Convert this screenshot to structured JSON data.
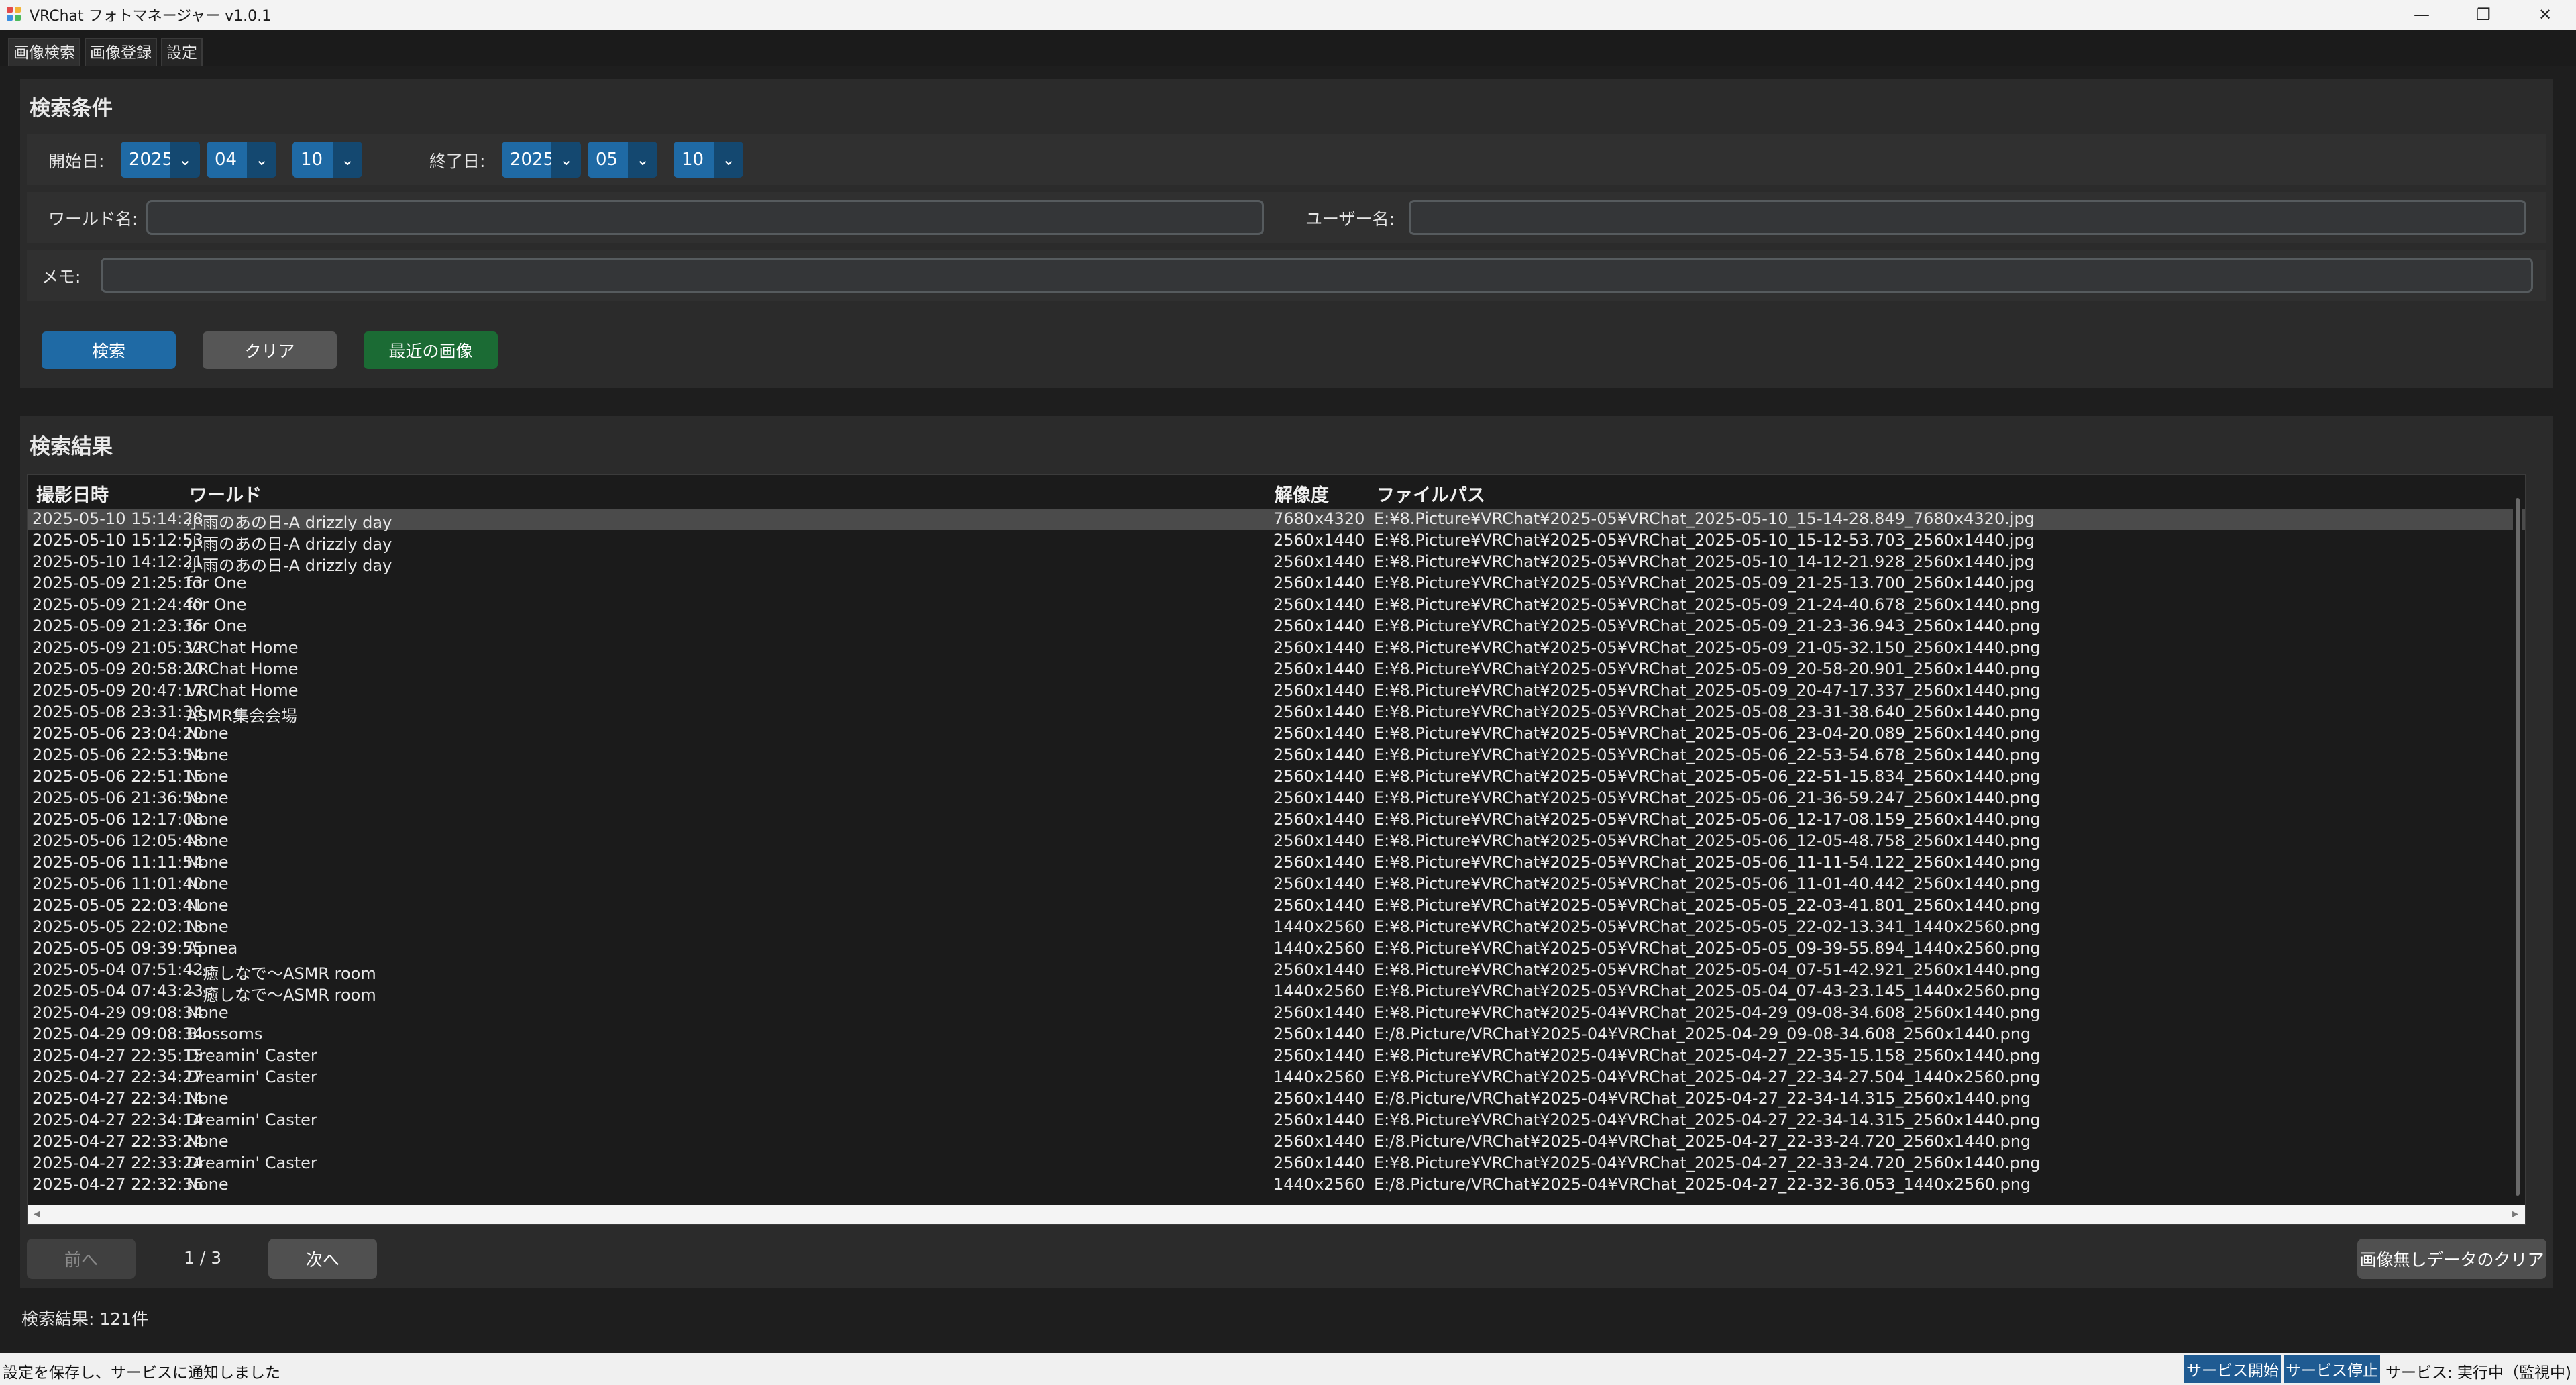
{
  "window": {
    "title": "VRChat フォトマネージャー v1.0.1",
    "controls": [
      "—",
      "❐",
      "✕"
    ]
  },
  "tabs": [
    "画像検索",
    "画像登録",
    "設定"
  ],
  "search": {
    "title": "検索条件",
    "start_label": "開始日:",
    "start": {
      "year": "2025",
      "month": "04",
      "day": "10"
    },
    "end_label": "終了日:",
    "end": {
      "year": "2025",
      "month": "05",
      "day": "10"
    },
    "world_label": "ワールド名:",
    "world_value": "",
    "user_label": "ユーザー名:",
    "user_value": "",
    "memo_label": "メモ:",
    "memo_value": "",
    "search_btn": "検索",
    "clear_btn": "クリア",
    "recent_btn": "最近の画像"
  },
  "results": {
    "title": "検索結果",
    "columns": [
      "撮影日時",
      "ワールド",
      "解像度",
      "ファイルパス"
    ],
    "rows": [
      [
        "2025-05-10 15:14:28",
        "小雨のあの日-A drizzly day",
        "7680x4320",
        "E:¥8.Picture¥VRChat¥2025-05¥VRChat_2025-05-10_15-14-28.849_7680x4320.jpg"
      ],
      [
        "2025-05-10 15:12:53",
        "小雨のあの日-A drizzly day",
        "2560x1440",
        "E:¥8.Picture¥VRChat¥2025-05¥VRChat_2025-05-10_15-12-53.703_2560x1440.jpg"
      ],
      [
        "2025-05-10 14:12:21",
        "小雨のあの日-A drizzly day",
        "2560x1440",
        "E:¥8.Picture¥VRChat¥2025-05¥VRChat_2025-05-10_14-12-21.928_2560x1440.jpg"
      ],
      [
        "2025-05-09 21:25:13",
        "for One",
        "2560x1440",
        "E:¥8.Picture¥VRChat¥2025-05¥VRChat_2025-05-09_21-25-13.700_2560x1440.jpg"
      ],
      [
        "2025-05-09 21:24:40",
        "for One",
        "2560x1440",
        "E:¥8.Picture¥VRChat¥2025-05¥VRChat_2025-05-09_21-24-40.678_2560x1440.png"
      ],
      [
        "2025-05-09 21:23:36",
        "for One",
        "2560x1440",
        "E:¥8.Picture¥VRChat¥2025-05¥VRChat_2025-05-09_21-23-36.943_2560x1440.png"
      ],
      [
        "2025-05-09 21:05:32",
        "VRChat Home",
        "2560x1440",
        "E:¥8.Picture¥VRChat¥2025-05¥VRChat_2025-05-09_21-05-32.150_2560x1440.png"
      ],
      [
        "2025-05-09 20:58:20",
        "VRChat Home",
        "2560x1440",
        "E:¥8.Picture¥VRChat¥2025-05¥VRChat_2025-05-09_20-58-20.901_2560x1440.png"
      ],
      [
        "2025-05-09 20:47:17",
        "VRChat Home",
        "2560x1440",
        "E:¥8.Picture¥VRChat¥2025-05¥VRChat_2025-05-09_20-47-17.337_2560x1440.png"
      ],
      [
        "2025-05-08 23:31:38",
        "ASMR集会会場",
        "2560x1440",
        "E:¥8.Picture¥VRChat¥2025-05¥VRChat_2025-05-08_23-31-38.640_2560x1440.png"
      ],
      [
        "2025-05-06 23:04:20",
        "None",
        "2560x1440",
        "E:¥8.Picture¥VRChat¥2025-05¥VRChat_2025-05-06_23-04-20.089_2560x1440.png"
      ],
      [
        "2025-05-06 22:53:54",
        "None",
        "2560x1440",
        "E:¥8.Picture¥VRChat¥2025-05¥VRChat_2025-05-06_22-53-54.678_2560x1440.png"
      ],
      [
        "2025-05-06 22:51:15",
        "None",
        "2560x1440",
        "E:¥8.Picture¥VRChat¥2025-05¥VRChat_2025-05-06_22-51-15.834_2560x1440.png"
      ],
      [
        "2025-05-06 21:36:59",
        "None",
        "2560x1440",
        "E:¥8.Picture¥VRChat¥2025-05¥VRChat_2025-05-06_21-36-59.247_2560x1440.png"
      ],
      [
        "2025-05-06 12:17:08",
        "None",
        "2560x1440",
        "E:¥8.Picture¥VRChat¥2025-05¥VRChat_2025-05-06_12-17-08.159_2560x1440.png"
      ],
      [
        "2025-05-06 12:05:48",
        "None",
        "2560x1440",
        "E:¥8.Picture¥VRChat¥2025-05¥VRChat_2025-05-06_12-05-48.758_2560x1440.png"
      ],
      [
        "2025-05-06 11:11:54",
        "None",
        "2560x1440",
        "E:¥8.Picture¥VRChat¥2025-05¥VRChat_2025-05-06_11-11-54.122_2560x1440.png"
      ],
      [
        "2025-05-06 11:01:40",
        "None",
        "2560x1440",
        "E:¥8.Picture¥VRChat¥2025-05¥VRChat_2025-05-06_11-01-40.442_2560x1440.png"
      ],
      [
        "2025-05-05 22:03:41",
        "None",
        "2560x1440",
        "E:¥8.Picture¥VRChat¥2025-05¥VRChat_2025-05-05_22-03-41.801_2560x1440.png"
      ],
      [
        "2025-05-05 22:02:13",
        "None",
        "1440x2560",
        "E:¥8.Picture¥VRChat¥2025-05¥VRChat_2025-05-05_22-02-13.341_1440x2560.png"
      ],
      [
        "2025-05-05 09:39:55",
        "Apnea",
        "1440x2560",
        "E:¥8.Picture¥VRChat¥2025-05¥VRChat_2025-05-05_09-39-55.894_1440x2560.png"
      ],
      [
        "2025-05-04 07:51:42",
        "～癒しなで～ASMR room",
        "2560x1440",
        "E:¥8.Picture¥VRChat¥2025-05¥VRChat_2025-05-04_07-51-42.921_2560x1440.png"
      ],
      [
        "2025-05-04 07:43:23",
        "～癒しなで～ASMR room",
        "1440x2560",
        "E:¥8.Picture¥VRChat¥2025-05¥VRChat_2025-05-04_07-43-23.145_1440x2560.png"
      ],
      [
        "2025-04-29 09:08:34",
        "None",
        "2560x1440",
        "E:¥8.Picture¥VRChat¥2025-04¥VRChat_2025-04-29_09-08-34.608_2560x1440.png"
      ],
      [
        "2025-04-29 09:08:34",
        "Blossoms",
        "2560x1440",
        "E:/8.Picture/VRChat¥2025-04¥VRChat_2025-04-29_09-08-34.608_2560x1440.png"
      ],
      [
        "2025-04-27 22:35:15",
        "Dreamin' Caster",
        "2560x1440",
        "E:¥8.Picture¥VRChat¥2025-04¥VRChat_2025-04-27_22-35-15.158_2560x1440.png"
      ],
      [
        "2025-04-27 22:34:27",
        "Dreamin' Caster",
        "1440x2560",
        "E:¥8.Picture¥VRChat¥2025-04¥VRChat_2025-04-27_22-34-27.504_1440x2560.png"
      ],
      [
        "2025-04-27 22:34:14",
        "None",
        "2560x1440",
        "E:/8.Picture/VRChat¥2025-04¥VRChat_2025-04-27_22-34-14.315_2560x1440.png"
      ],
      [
        "2025-04-27 22:34:14",
        "Dreamin' Caster",
        "2560x1440",
        "E:¥8.Picture¥VRChat¥2025-04¥VRChat_2025-04-27_22-34-14.315_2560x1440.png"
      ],
      [
        "2025-04-27 22:33:24",
        "None",
        "2560x1440",
        "E:/8.Picture/VRChat¥2025-04¥VRChat_2025-04-27_22-33-24.720_2560x1440.png"
      ],
      [
        "2025-04-27 22:33:24",
        "Dreamin' Caster",
        "2560x1440",
        "E:¥8.Picture¥VRChat¥2025-04¥VRChat_2025-04-27_22-33-24.720_2560x1440.png"
      ],
      [
        "2025-04-27 22:32:36",
        "None",
        "1440x2560",
        "E:/8.Picture/VRChat¥2025-04¥VRChat_2025-04-27_22-32-36.053_1440x2560.png"
      ]
    ]
  },
  "pager": {
    "prev": "前へ",
    "page": "1 / 3",
    "next": "次へ",
    "clear_missing": "画像無しデータのクリア"
  },
  "result_count": "検索結果: 121件",
  "statusbar": {
    "message": "設定を保存し、サービスに通知しました",
    "start_service": "サービス開始",
    "stop_service": "サービス停止",
    "status": "サービス: 実行中（監視中)"
  }
}
